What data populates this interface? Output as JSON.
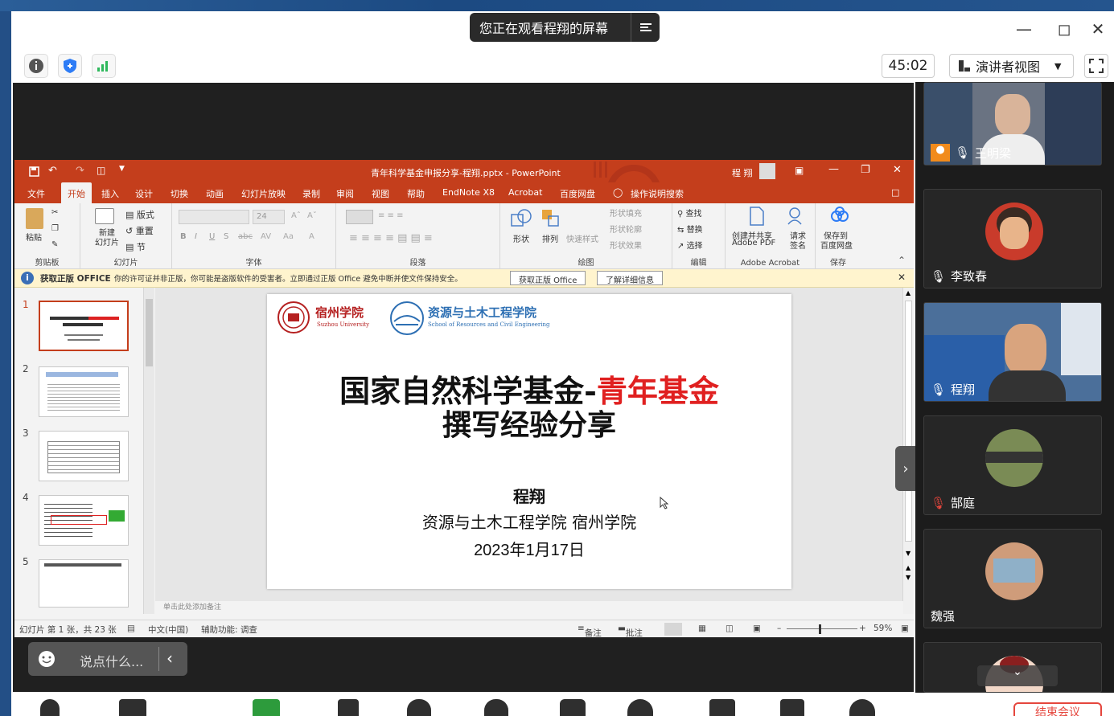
{
  "zoom": {
    "share_banner": "您正在观看程翔的屏幕",
    "timer": "45:02",
    "view_mode": "演讲者视图"
  },
  "ppt": {
    "window_title": "青年科学基金申报分享-程翔.pptx  -  PowerPoint",
    "user": "程 翔",
    "tabs": [
      "文件",
      "开始",
      "插入",
      "设计",
      "切换",
      "动画",
      "幻灯片放映",
      "录制",
      "审阅",
      "视图",
      "帮助",
      "EndNote X8",
      "Acrobat",
      "百度网盘"
    ],
    "tell_me": "操作说明搜索",
    "ribbon": {
      "paste": "粘贴",
      "new_slide": "新建\n幻灯片",
      "layout": "版式",
      "reset": "重置",
      "section": "节",
      "font_size": "24",
      "shape": "形状",
      "arrange": "排列",
      "quick_style": "快速样式",
      "shape_fill": "形状填充",
      "shape_outline": "形状轮廓",
      "shape_effect": "形状效果",
      "find": "查找",
      "replace": "替换",
      "select": "选择",
      "create_share": "创建并共享",
      "adobe_pdf": "Adobe PDF",
      "request_sign": "请求",
      "sign": "签名",
      "save_to": "保存到",
      "baidu": "百度网盘",
      "groups": {
        "clipboard": "剪贴板",
        "slides": "幻灯片",
        "font": "字体",
        "paragraph": "段落",
        "drawing": "绘图",
        "editing": "编辑",
        "acrobat": "Adobe Acrobat",
        "save": "保存"
      }
    },
    "notice": {
      "title": "获取正版 OFFICE",
      "text": "你的许可证并非正版，你可能是盗版软件的受害者。立即通过正版 Office 避免中断并使文件保持安全。",
      "btn1": "获取正版 Office",
      "btn2": "了解详细信息"
    },
    "thumb_numbers": [
      "1",
      "2",
      "3",
      "4",
      "5"
    ],
    "slide": {
      "univ_cn": "宿州学院",
      "univ_en": "Suzhou University",
      "school_cn": "资源与土木工程学院",
      "school_en": "School of Resources and Civil Engineering",
      "title_black": "国家自然科学基金-",
      "title_red": "青年基金",
      "title_line2": "撰写经验分享",
      "presenter": "程翔",
      "affiliation": "资源与土木工程学院  宿州学院",
      "date": "2023年1月17日"
    },
    "notes_hint": "单击此处添加备注",
    "status": {
      "slide_count": "幻灯片 第 1 张，共 23 张",
      "language": "中文(中国)",
      "accessibility": "辅助功能: 调查",
      "notes": "备注",
      "comments": "批注",
      "zoom": "59%"
    }
  },
  "chat_placeholder": "说点什么...",
  "participants": [
    {
      "name": "王明梁"
    },
    {
      "name": "李致春"
    },
    {
      "name": "程翔"
    },
    {
      "name": "郜庭"
    },
    {
      "name": "魏强"
    },
    {
      "name": ""
    }
  ],
  "end_button": "结束会议"
}
